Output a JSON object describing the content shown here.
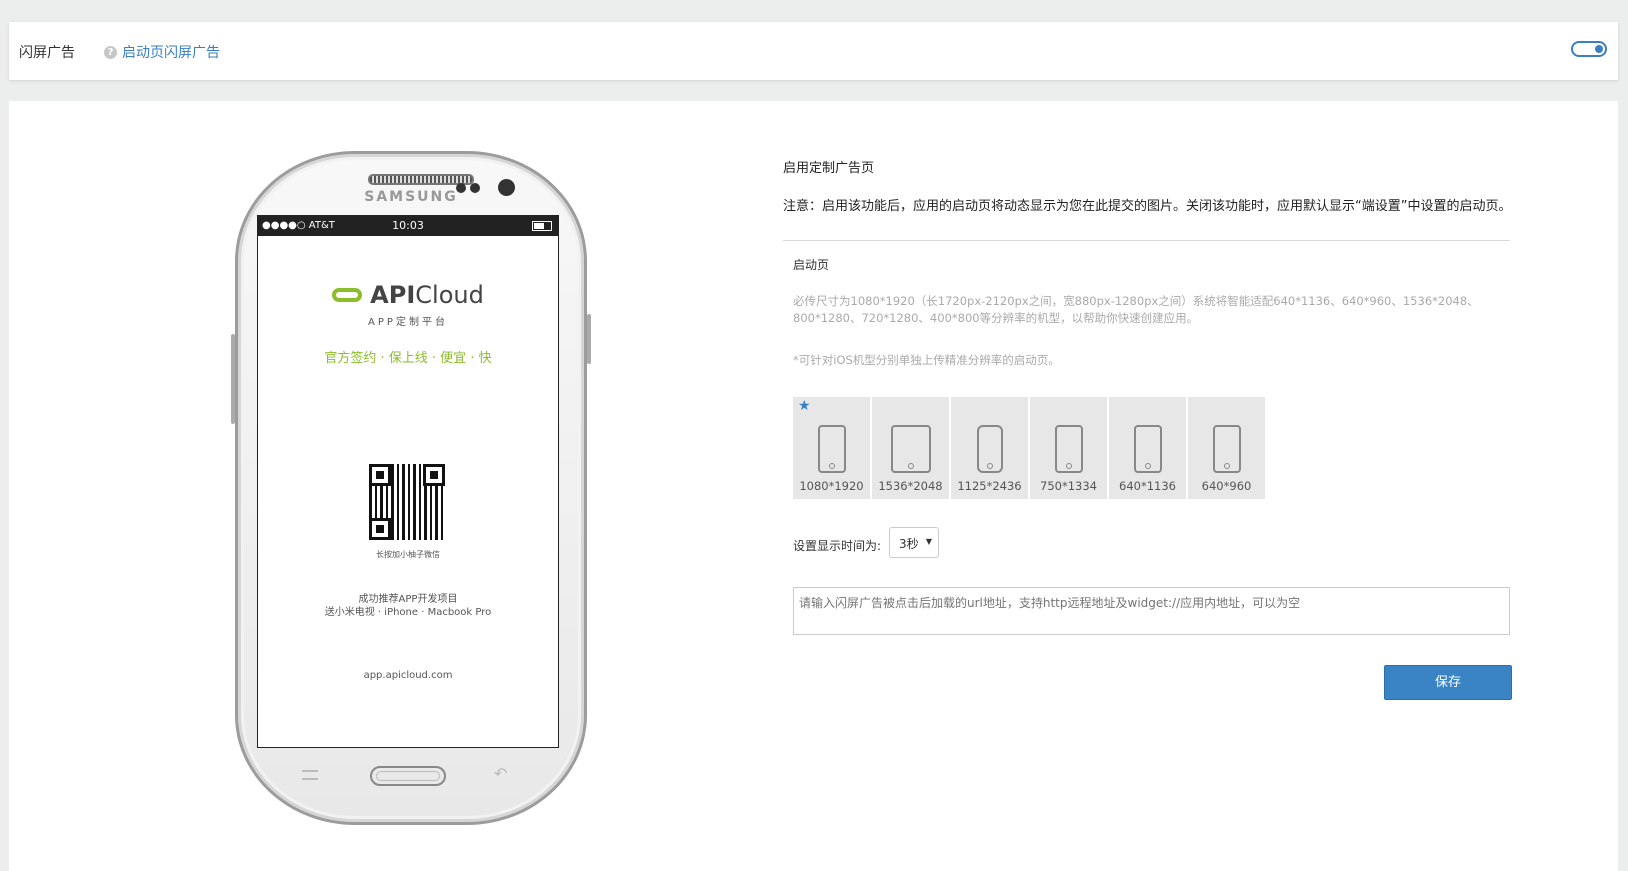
{
  "header": {
    "title": "闪屏广告",
    "help_link": "启动页闪屏广告",
    "toggle_on": true
  },
  "phone": {
    "brand": "SAMSUNG",
    "status_left": "●●●●○ AT&T",
    "status_time": "10:03",
    "logo_prefix": "API",
    "logo_suffix": "Cloud",
    "logo_sub": "APP定制平台",
    "tagline": "官方签约 · 保上线 · 便宜 · 快",
    "qr_caption": "长按加小柚子微信",
    "promo_line1": "成功推荐APP开发项目",
    "promo_line2": "送小米电视 · iPhone · Macbook Pro",
    "url": "app.apicloud.com"
  },
  "settings": {
    "title": "启用定制广告页",
    "note": "注意：启用该功能后，应用的启动页将动态显示为您在此提交的图片。关闭该功能时，应用默认显示“端设置”中设置的启动页。",
    "section_label": "启动页",
    "requirement": "必传尺寸为1080*1920（长1720px-2120px之间，宽880px-1280px之间）系统将智能适配640*1136、640*960、1536*2048、800*1280、720*1280、400*800等分辨率的机型，以帮助你快速创建应用。",
    "ios_note": "*可针对iOS机型分别单独上传精准分辨率的启动页。",
    "devices": [
      {
        "label": "1080*1920",
        "icon": "android-phone-icon",
        "starred": true
      },
      {
        "label": "1536*2048",
        "icon": "tablet-icon",
        "starred": false
      },
      {
        "label": "1125*2436",
        "icon": "iphone-x-icon",
        "starred": false
      },
      {
        "label": "750*1334",
        "icon": "iphone-icon",
        "starred": false
      },
      {
        "label": "640*1136",
        "icon": "iphone-icon",
        "starred": false
      },
      {
        "label": "640*960",
        "icon": "iphone-icon",
        "starred": false
      }
    ],
    "duration_label": "设置显示时间为:",
    "duration_value": "3秒",
    "url_placeholder": "请输入闪屏广告被点击后加载的url地址，支持http远程地址及widget://应用内地址，可以为空",
    "save_label": "保存"
  },
  "colors": {
    "accent": "#3a83c5",
    "brand_green": "#8cbd2a"
  }
}
